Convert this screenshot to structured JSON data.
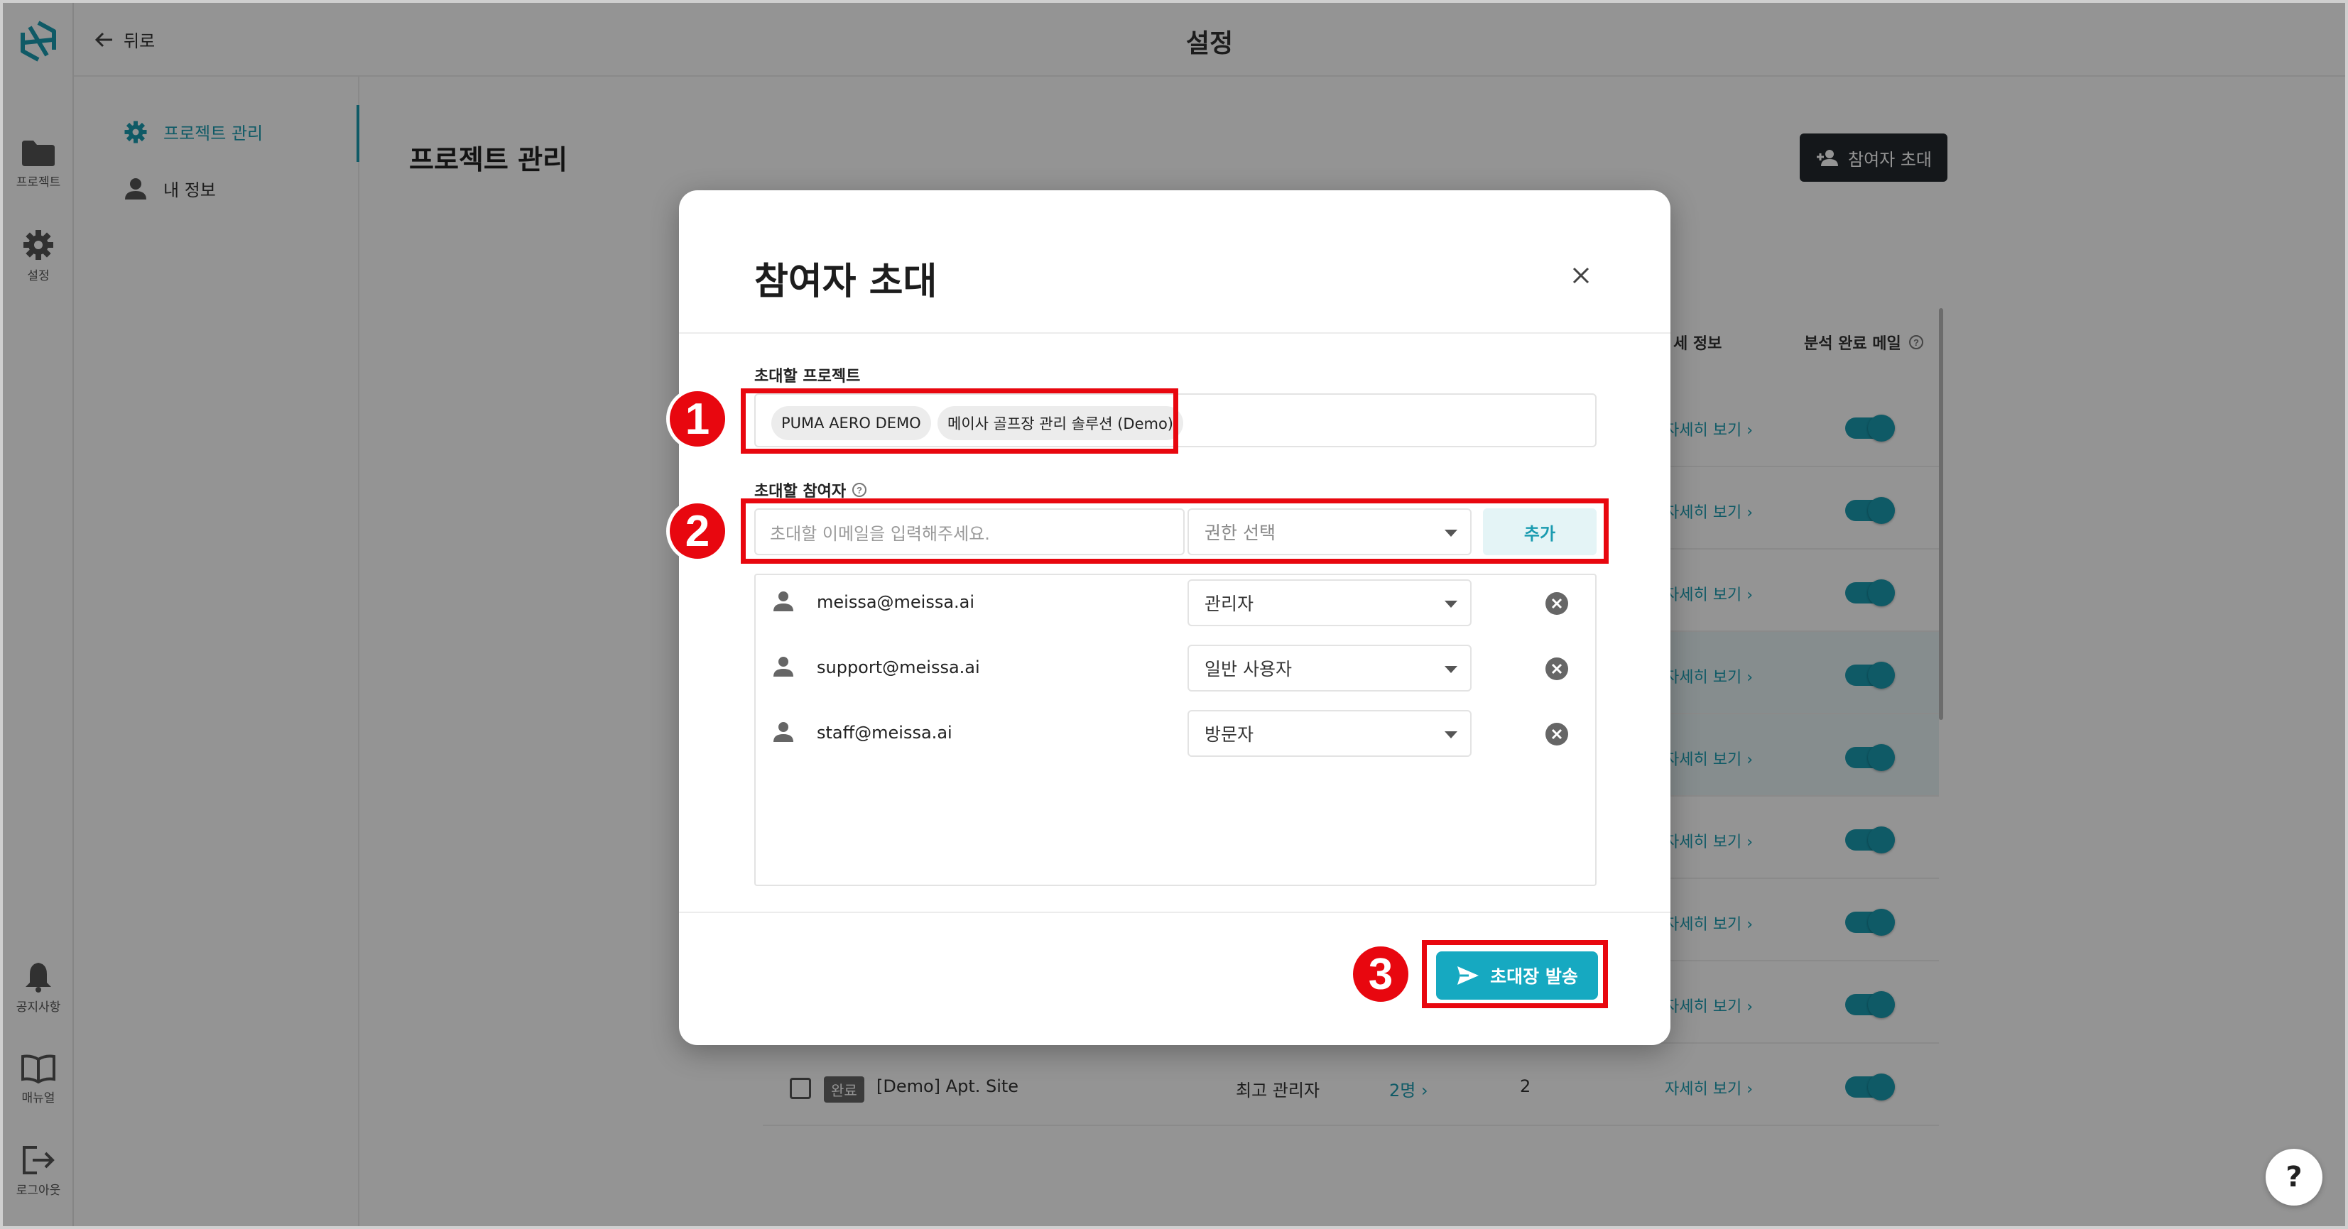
{
  "rail": {
    "project_label": "프로젝트",
    "settings_label": "설정",
    "notice_label": "공지사항",
    "manual_label": "매뉴얼",
    "logout_label": "로그아웃"
  },
  "topbar": {
    "back_label": "뒤로",
    "title": "설정"
  },
  "subnav": {
    "items": [
      {
        "label": "프로젝트 관리",
        "icon": "gear-icon",
        "active": true
      },
      {
        "label": "내 정보",
        "icon": "person-icon",
        "active": false
      }
    ]
  },
  "page": {
    "title": "프로젝트 관리",
    "invite_button": "참여자 초대",
    "columns": {
      "detail_info": "세 정보",
      "analysis_mail": "분석 완료 메일"
    },
    "detail_link": "자세히 보기",
    "last_row": {
      "status": "완료",
      "name": "[Demo] Apt. Site",
      "role": "최고 관리자",
      "members": "2명",
      "count": "2",
      "detail": "자세히 보기"
    }
  },
  "modal": {
    "title": "참여자 초대",
    "project_label": "초대할 프로젝트",
    "projects": [
      "PUMA AERO DEMO",
      "메이사 골프장 관리 솔루션 (Demo)"
    ],
    "participant_label": "초대할 참여자",
    "email_placeholder": "초대할 이메일을 입력해주세요.",
    "role_placeholder": "권한 선택",
    "add_button": "추가",
    "participants": [
      {
        "email": "meissa@meissa.ai",
        "role": "관리자"
      },
      {
        "email": "support@meissa.ai",
        "role": "일반 사용자"
      },
      {
        "email": "staff@meissa.ai",
        "role": "방문자"
      }
    ],
    "send_button": "초대장 발송"
  },
  "annotations": [
    "1",
    "2",
    "3"
  ],
  "help": "?",
  "colors": {
    "accent": "#1a9bb0",
    "button_teal": "#16a9c1",
    "annotation_red": "#e8070f",
    "dark_button": "#23292e"
  }
}
